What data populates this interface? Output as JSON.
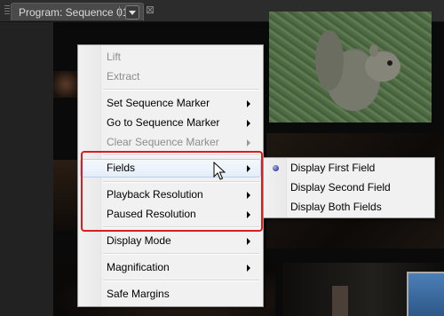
{
  "panel": {
    "tab_title": "Program: Sequence 01",
    "menu_icon": "chevron-down-icon",
    "close_glyph": "⊠"
  },
  "context_menu": {
    "items": [
      {
        "label": "Lift",
        "enabled": false,
        "submenu": false
      },
      {
        "label": "Extract",
        "enabled": false,
        "submenu": false
      },
      {
        "label": "Set Sequence Marker",
        "enabled": true,
        "submenu": true
      },
      {
        "label": "Go to Sequence Marker",
        "enabled": true,
        "submenu": true
      },
      {
        "label": "Clear Sequence Marker",
        "enabled": false,
        "submenu": true
      },
      {
        "label": "Fields",
        "enabled": true,
        "submenu": true,
        "hovered": true
      },
      {
        "label": "Playback Resolution",
        "enabled": true,
        "submenu": true
      },
      {
        "label": "Paused Resolution",
        "enabled": true,
        "submenu": true
      },
      {
        "label": "Display Mode",
        "enabled": true,
        "submenu": true
      },
      {
        "label": "Magnification",
        "enabled": true,
        "submenu": true
      },
      {
        "label": "Safe Margins",
        "enabled": true,
        "submenu": false
      }
    ]
  },
  "fields_submenu": {
    "items": [
      {
        "label": "Display First Field",
        "selected": true
      },
      {
        "label": "Display Second Field",
        "selected": false
      },
      {
        "label": "Display Both Fields",
        "selected": false
      }
    ]
  },
  "colors": {
    "highlight_box": "#d81e1e",
    "menu_background": "#f1f1f1",
    "hover_border": "#b9d0ec",
    "radio": "#3a4aa8"
  }
}
